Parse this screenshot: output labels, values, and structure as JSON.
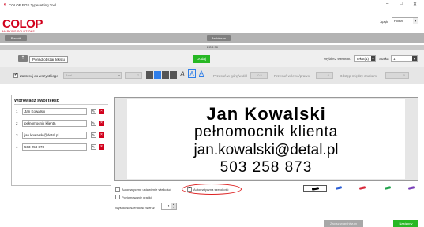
{
  "window": {
    "title": "COLOP EOS Typesetting Tool",
    "min_glyph": "–",
    "max_glyph": "□",
    "close_glyph": "✕"
  },
  "logo": {
    "brand": "COLOP",
    "tagline": "MARKING SOLUTIONS"
  },
  "language": {
    "label": "Język:",
    "value": "Polish"
  },
  "topbar": {
    "back_label": "Powrót",
    "archive_label": "Archiwum"
  },
  "stamp_model": {
    "label": "EOS 30"
  },
  "toolbar": {
    "add_line_label": "Ponad obszar tekstu",
    "add_button_label": "Dodaj",
    "select_element_label": "Wybierz element",
    "select_element_value": "Tekst(1)",
    "stamp_label": "Stałka",
    "stamp_value": "1"
  },
  "format": {
    "apply_all_label": "Zastosuj do wszystkiego",
    "font_value": "Arial",
    "size_value": "7",
    "shift_label": "Przesuń w górę/w dół",
    "shift_value": "0.5",
    "shift_h_label": "Przesuń w lewo/prawo",
    "shift_h_value": "0",
    "spacing_label": "Odstęp między znakami",
    "spacing_value": "0"
  },
  "text_panel": {
    "title": "Wprowadź swój tekst:",
    "lines": [
      {
        "num": "1",
        "value": "Jan Kowalski"
      },
      {
        "num": "2",
        "value": "pełnomocnik klienta"
      },
      {
        "num": "3",
        "value": "jan.kowalski@detal.pl"
      },
      {
        "num": "4",
        "value": "503 258 873"
      }
    ]
  },
  "preview": {
    "lines": [
      "Jan Kowalski",
      "pełnomocnik klienta",
      "jan.kowalski@detal.pl",
      "503 258 873"
    ]
  },
  "options": {
    "auto_size_label": "Automatyczne ustawienie wielkości",
    "auto_width_label": "Automatyczna szerokość",
    "horizontal_graphic_label": "Poziomowanie grafiki",
    "line_height_label": "Wysokość/szerokość wiersz",
    "line_height_value": "1"
  },
  "ink_colors": [
    "#000000",
    "#2c5fd6",
    "#d8283a",
    "#1fa24a",
    "#7a3fb8"
  ],
  "bottom": {
    "preview_label": "Zapisz w archiwum",
    "next_label": "Następny"
  },
  "colors": {
    "brand_red": "#d1001c",
    "green": "#27b824",
    "annotation": "#d22"
  }
}
